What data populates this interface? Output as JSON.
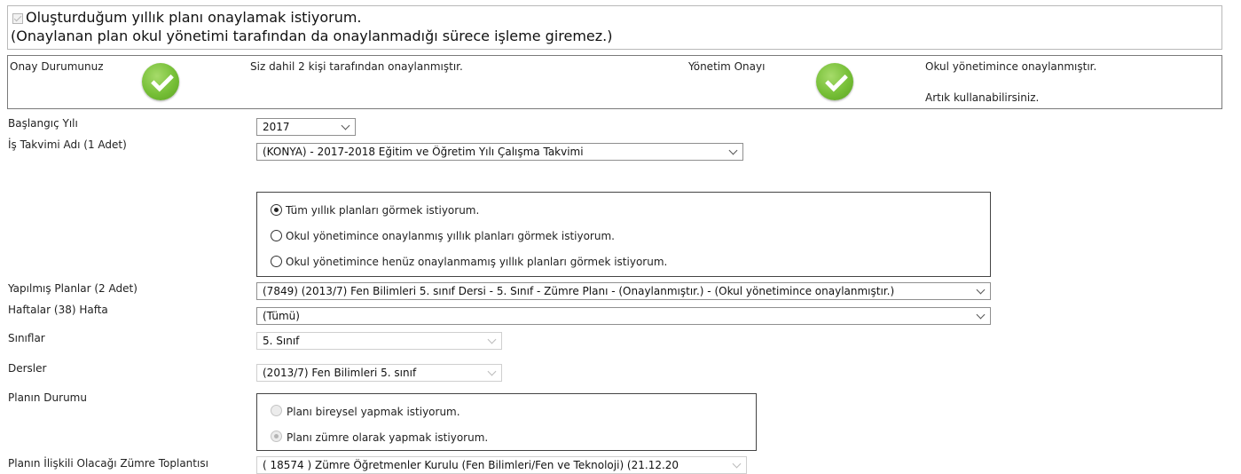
{
  "approval": {
    "line1": "Oluşturduğum yıllık planı onaylamak istiyorum.",
    "line2": "(Onaylanan plan okul yönetimi tarafından da onaylanmadığı sürece işleme giremez.)",
    "checked": true
  },
  "status": {
    "my_label": "Onay Durumunuz",
    "my_text": "Siz dahil 2 kişi tarafından onaylanmıştır.",
    "mgmt_label": "Yönetim Onayı",
    "mgmt_text1": "Okul yönetimince onaylanmıştır.",
    "mgmt_text2": "Artık kullanabilirsiniz.",
    "check_color": "#76bf37"
  },
  "form": {
    "start_year_label": "Başlangıç Yılı",
    "start_year_value": "2017",
    "calendar_label": "İş Takvimi Adı (1 Adet)",
    "calendar_value": "(KONYA) - 2017-2018 Eğitim ve Öğretim Yılı Çalışma Takvimi",
    "filter_options": [
      {
        "label": "Tüm yıllık planları görmek istiyorum.",
        "checked": true
      },
      {
        "label": "Okul yönetimince onaylanmış yıllık planları görmek istiyorum.",
        "checked": false
      },
      {
        "label": "Okul yönetimince henüz onaylanmamış yıllık planları görmek istiyorum.",
        "checked": false
      }
    ],
    "plans_label": "Yapılmış Planlar (2 Adet)",
    "plans_value": "(7849) (2013/7) Fen Bilimleri 5. sınıf Dersi - 5. Sınıf - Zümre Planı - (Onaylanmıştır.) - (Okul yönetimince onaylanmıştır.)",
    "weeks_label": "Haftalar (38) Hafta",
    "weeks_value": "(Tümü)",
    "classes_label": "Sınıflar",
    "classes_value": "5. Sınıf",
    "courses_label": "Dersler",
    "courses_value": "(2013/7) Fen Bilimleri 5. sınıf",
    "plan_status_label": "Planın Durumu",
    "plan_status_options": [
      {
        "label": "Planı bireysel yapmak istiyorum.",
        "checked": false
      },
      {
        "label": "Planı zümre olarak yapmak istiyorum.",
        "checked": true
      }
    ],
    "meeting_label": "Planın İlişkili Olacağı Zümre Toplantısı",
    "meeting_value": "( 18574 ) Zümre Öğretmenler Kurulu (Fen Bilimleri/Fen ve Teknoloji) (21.12.20"
  }
}
